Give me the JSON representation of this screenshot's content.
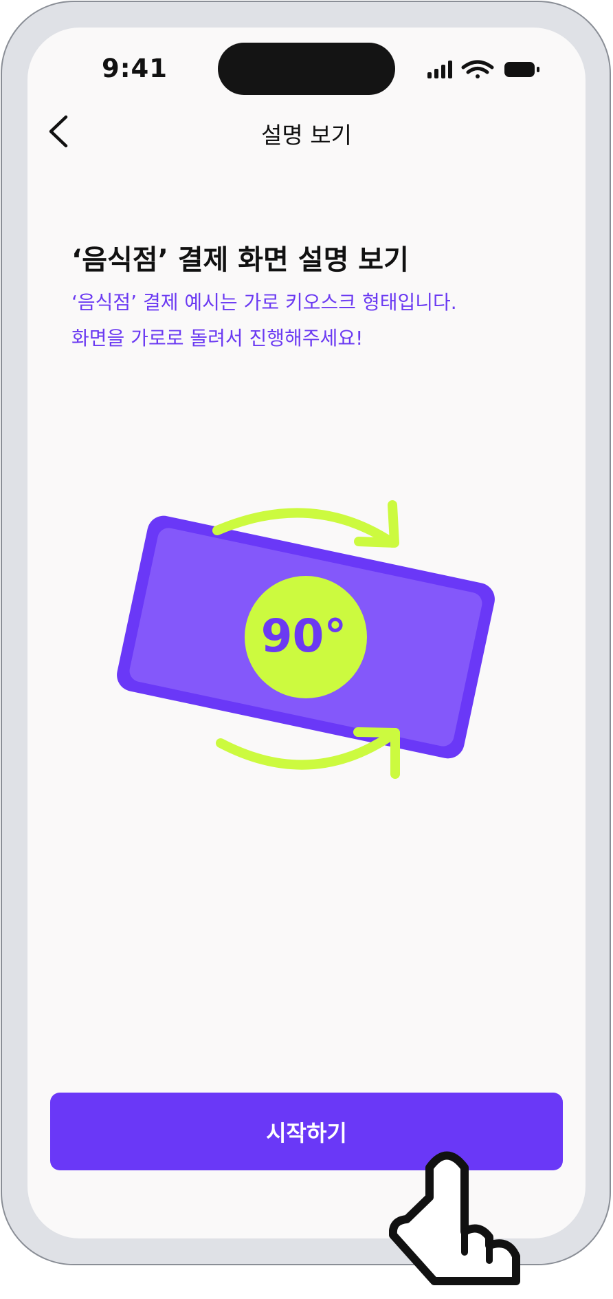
{
  "status_bar": {
    "time": "9:41"
  },
  "nav": {
    "title": "설명 보기"
  },
  "content": {
    "heading": "‘음식점’ 결제 화면 설명 보기",
    "description_line1": "‘음식점’ 결제 예시는 가로 키오스크 형태입니다.",
    "description_line2": "화면을 가로로 돌려서 진행해주세요!"
  },
  "illustration": {
    "rotation_label": "90°"
  },
  "actions": {
    "start_label": "시작하기"
  },
  "colors": {
    "accent": "#6a38f7",
    "accent_light": "#8458fa",
    "lime": "#ccfa3f",
    "frame": "#dfe1e6",
    "screen": "#faf9f9"
  }
}
